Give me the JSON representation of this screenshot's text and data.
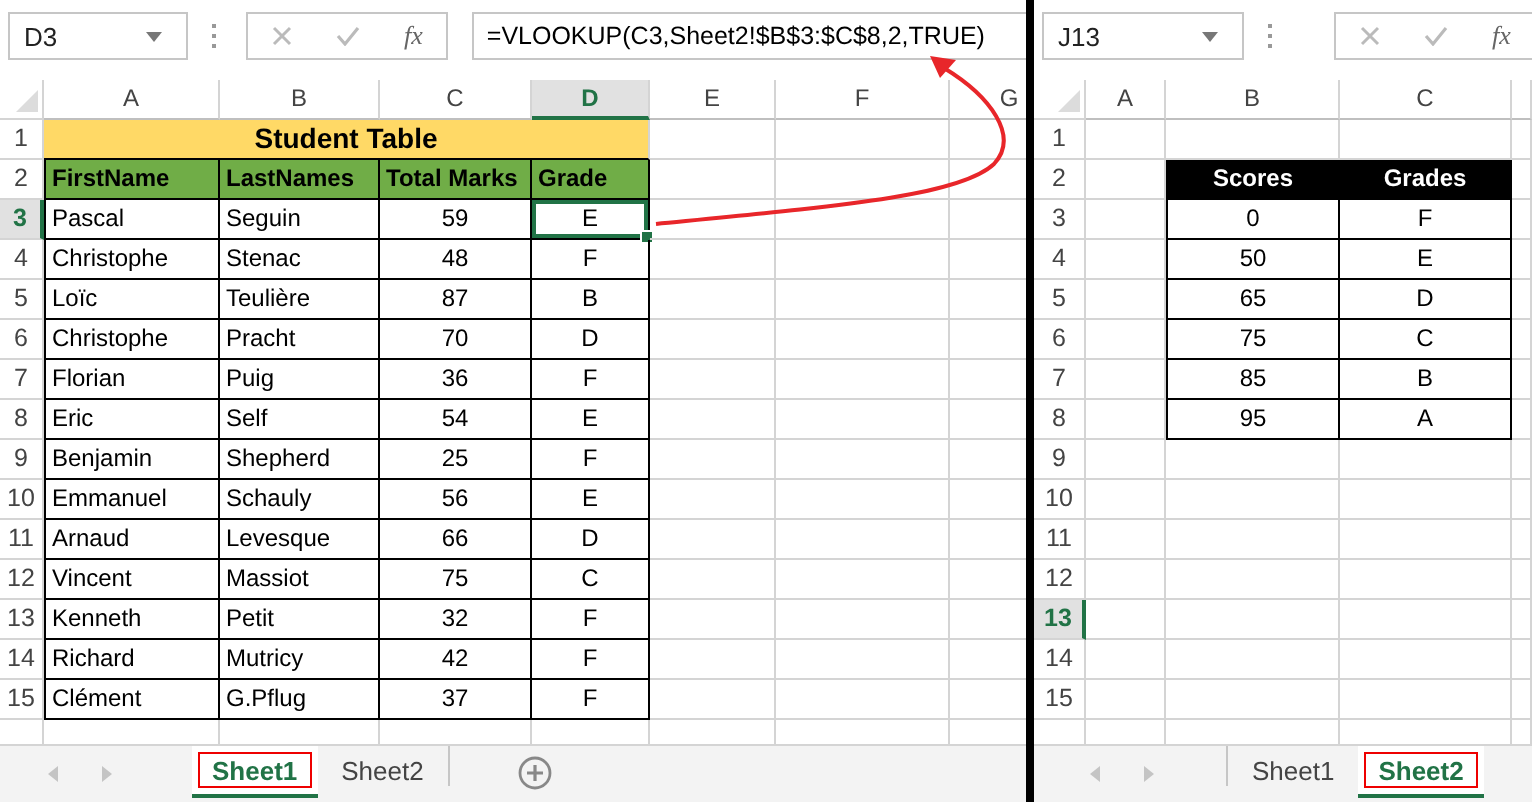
{
  "panes": [
    {
      "kind": "student-table",
      "table_title": "Student Table",
      "name_box": "D3",
      "function_button": "fx",
      "formula": "=VLOOKUP(C3,Sheet2!$B$3:$C$8,2,TRUE)",
      "columns": [
        {
          "label": "A",
          "selected": false
        },
        {
          "label": "B",
          "selected": false
        },
        {
          "label": "C",
          "selected": false
        },
        {
          "label": "D",
          "selected": true
        },
        {
          "label": "E",
          "selected": false
        },
        {
          "label": "F",
          "selected": false
        },
        {
          "label": "G",
          "selected": false
        }
      ],
      "rows": [
        {
          "label": "1",
          "selected": false,
          "kind": "title"
        },
        {
          "label": "2",
          "selected": false,
          "kind": "header",
          "cells": [
            "FirstName",
            "LastNames",
            "Total Marks",
            "Grade"
          ]
        },
        {
          "label": "3",
          "selected": true,
          "kind": "data",
          "cells": [
            "Pascal",
            "Seguin",
            "59",
            "E"
          ]
        },
        {
          "label": "4",
          "selected": false,
          "kind": "data",
          "cells": [
            "Christophe",
            "Stenac",
            "48",
            "F"
          ]
        },
        {
          "label": "5",
          "selected": false,
          "kind": "data",
          "cells": [
            "Loïc",
            "Teulière",
            "87",
            "B"
          ]
        },
        {
          "label": "6",
          "selected": false,
          "kind": "data",
          "cells": [
            "Christophe",
            "Pracht",
            "70",
            "D"
          ]
        },
        {
          "label": "7",
          "selected": false,
          "kind": "data",
          "cells": [
            "Florian",
            "Puig",
            "36",
            "F"
          ]
        },
        {
          "label": "8",
          "selected": false,
          "kind": "data",
          "cells": [
            "Eric",
            "Self",
            "54",
            "E"
          ]
        },
        {
          "label": "9",
          "selected": false,
          "kind": "data",
          "cells": [
            "Benjamin",
            "Shepherd",
            "25",
            "F"
          ]
        },
        {
          "label": "10",
          "selected": false,
          "kind": "data",
          "cells": [
            "Emmanuel",
            "Schauly",
            "56",
            "E"
          ]
        },
        {
          "label": "11",
          "selected": false,
          "kind": "data",
          "cells": [
            "Arnaud",
            "Levesque",
            "66",
            "D"
          ]
        },
        {
          "label": "12",
          "selected": false,
          "kind": "data",
          "cells": [
            "Vincent",
            "Massiot",
            "75",
            "C"
          ]
        },
        {
          "label": "13",
          "selected": false,
          "kind": "data",
          "cells": [
            "Kenneth",
            "Petit",
            "32",
            "F"
          ]
        },
        {
          "label": "14",
          "selected": false,
          "kind": "data",
          "cells": [
            "Richard",
            "Mutricy",
            "42",
            "F"
          ]
        },
        {
          "label": "15",
          "selected": false,
          "kind": "data",
          "cells": [
            "Clément",
            "G.Pflug",
            "37",
            "F"
          ]
        }
      ],
      "sheet_tabs": [
        {
          "label": "Sheet1",
          "selected": true
        },
        {
          "label": "Sheet2",
          "selected": false
        }
      ]
    },
    {
      "kind": "lookup-table",
      "name_box": "J13",
      "function_button": "fx",
      "columns": [
        {
          "label": "A",
          "selected": false
        },
        {
          "label": "B",
          "selected": false
        },
        {
          "label": "C",
          "selected": false
        }
      ],
      "rows": [
        {
          "label": "1",
          "selected": false,
          "kind": "blank"
        },
        {
          "label": "2",
          "selected": false,
          "kind": "header",
          "cells": [
            "Scores",
            "Grades"
          ]
        },
        {
          "label": "3",
          "selected": false,
          "kind": "data",
          "cells": [
            "0",
            "F"
          ]
        },
        {
          "label": "4",
          "selected": false,
          "kind": "data",
          "cells": [
            "50",
            "E"
          ]
        },
        {
          "label": "5",
          "selected": false,
          "kind": "data",
          "cells": [
            "65",
            "D"
          ]
        },
        {
          "label": "6",
          "selected": false,
          "kind": "data",
          "cells": [
            "75",
            "C"
          ]
        },
        {
          "label": "7",
          "selected": false,
          "kind": "data",
          "cells": [
            "85",
            "B"
          ]
        },
        {
          "label": "8",
          "selected": false,
          "kind": "data",
          "cells": [
            "95",
            "A"
          ]
        },
        {
          "label": "9",
          "selected": false,
          "kind": "blank"
        },
        {
          "label": "10",
          "selected": false,
          "kind": "blank"
        },
        {
          "label": "11",
          "selected": false,
          "kind": "blank"
        },
        {
          "label": "12",
          "selected": false,
          "kind": "blank"
        },
        {
          "label": "13",
          "selected": true,
          "kind": "blank"
        },
        {
          "label": "14",
          "selected": false,
          "kind": "blank"
        },
        {
          "label": "15",
          "selected": false,
          "kind": "blank"
        }
      ],
      "sheet_tabs": [
        {
          "label": "Sheet1",
          "selected": false
        },
        {
          "label": "Sheet2",
          "selected": true
        }
      ]
    }
  ]
}
